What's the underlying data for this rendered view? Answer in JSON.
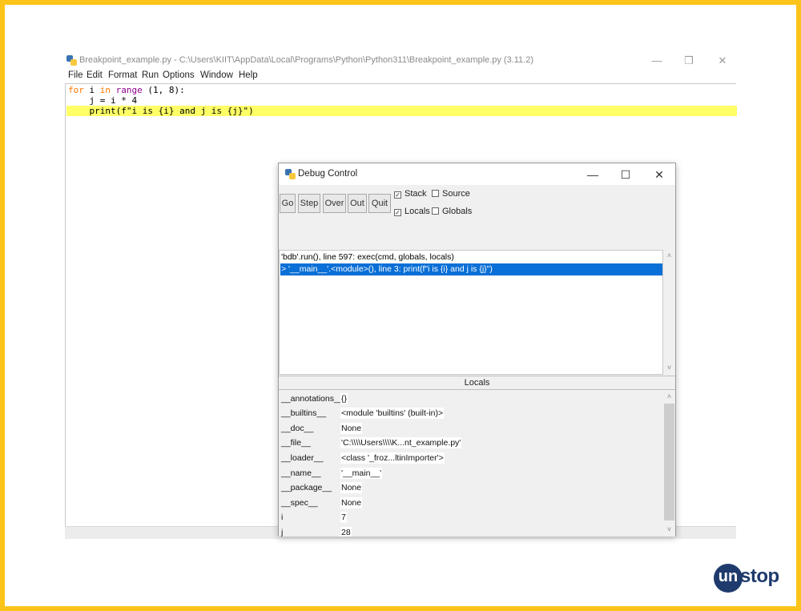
{
  "idle": {
    "title": "Breakpoint_example.py - C:\\Users\\KIIT\\AppData\\Local\\Programs\\Python\\Python311\\Breakpoint_example.py (3.11.2)",
    "window_controls": {
      "minimize": "—",
      "maximize": "❐",
      "close": "✕"
    },
    "menu": [
      "File",
      "Edit",
      "Format",
      "Run",
      "Options",
      "Window",
      "Help"
    ],
    "code": {
      "line1": {
        "kw1": "for",
        "p1": " i ",
        "kw2": "in",
        "p2": " ",
        "bi": "range",
        "p3": " (1, 8):"
      },
      "line2": "    j = i * 4",
      "line3": "    print(f\"i is {i} and j is {j}\")"
    },
    "highlight_color": "#ffff66"
  },
  "debug": {
    "title": "Debug Control",
    "window_controls": {
      "minimize": "—",
      "maximize": "☐",
      "close": "✕"
    },
    "buttons": {
      "go": "Go",
      "step": "Step",
      "over": "Over",
      "out": "Out",
      "quit": "Quit"
    },
    "checks": {
      "stack": {
        "label": "Stack",
        "checked": true,
        "mark": "✓"
      },
      "source": {
        "label": "Source",
        "checked": false,
        "mark": ""
      },
      "locals": {
        "label": "Locals",
        "checked": true,
        "mark": "✓"
      },
      "globals": {
        "label": "Globals",
        "checked": false,
        "mark": ""
      }
    },
    "stack_rows": [
      "'bdb'.run(), line 597: exec(cmd, globals, locals)",
      "> '__main__'.<module>(), line 3: print(f\"i is {i} and j is {j}\")"
    ],
    "selected_color": "#0a6fd6",
    "locals_header": "Locals",
    "locals": [
      {
        "name": "__annotations__",
        "value": "{}"
      },
      {
        "name": "__builtins__",
        "value": "<module 'builtins' (built-in)>"
      },
      {
        "name": "__doc__",
        "value": "None"
      },
      {
        "name": "__file__",
        "value": "'C:\\\\\\\\Users\\\\\\\\K...nt_example.py'"
      },
      {
        "name": "__loader__",
        "value": "<class '_froz...ltinImporter'>"
      },
      {
        "name": "__name__",
        "value": "'__main__'"
      },
      {
        "name": "__package__",
        "value": "None"
      },
      {
        "name": "__spec__",
        "value": "None"
      },
      {
        "name": "i",
        "value": "7"
      },
      {
        "name": "j",
        "value": "28"
      }
    ],
    "scroll_up": "˄",
    "scroll_down": "˅"
  },
  "logo": {
    "circle": "un",
    "text": "stop",
    "color": "#1f3a6d"
  },
  "frame_color": "#fcc419"
}
